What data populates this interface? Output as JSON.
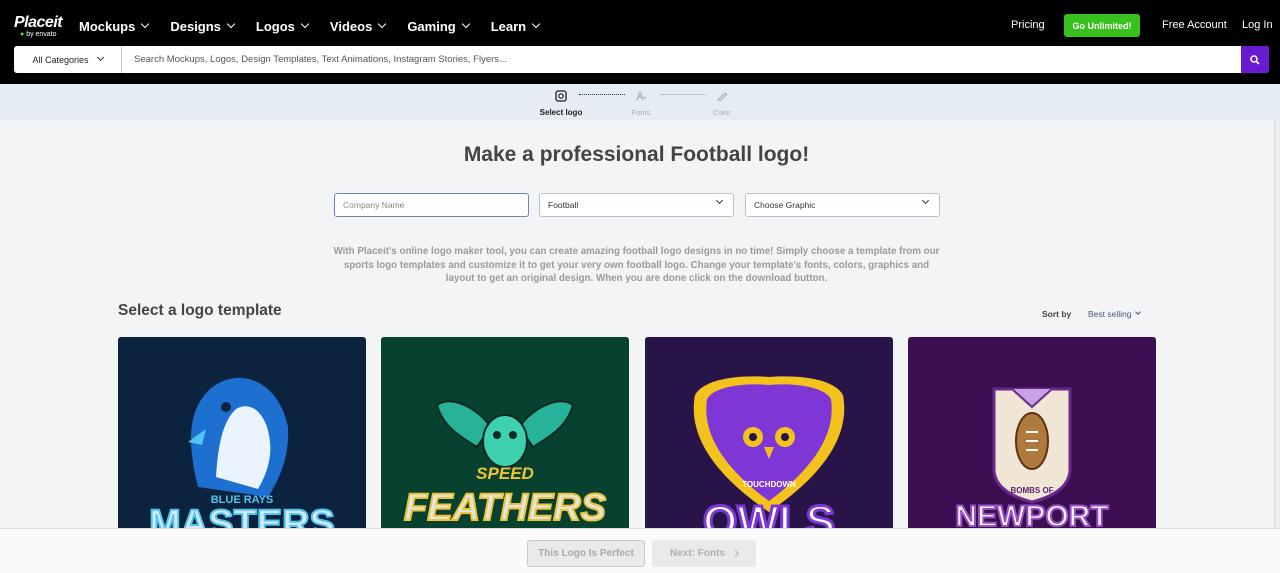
{
  "brand": {
    "name": "Placeit",
    "sub": "by envato"
  },
  "nav": {
    "menu": [
      "Mockups",
      "Designs",
      "Logos",
      "Videos",
      "Gaming",
      "Learn"
    ],
    "pricing": "Pricing",
    "cta": "Go Unlimited!",
    "free_account": "Free Account",
    "login": "Log In"
  },
  "search": {
    "category": "All Categories",
    "placeholder": "Search Mockups, Logos, Design Templates, Text Animations, Instagram Stories, Flyers..."
  },
  "steps": [
    {
      "label": "Select logo",
      "active": true
    },
    {
      "label": "Fonts",
      "active": false
    },
    {
      "label": "Color",
      "active": false
    }
  ],
  "main": {
    "title": "Make a professional Football logo!",
    "company_placeholder": "Company Name",
    "category_value": "Football",
    "graphic_value": "Choose Graphic",
    "description": "With Placeit's online logo maker tool, you can create amazing football logo designs in no time! Simply choose a template from our sports logo templates and customize it to get your very own football logo. Change your template's fonts, colors, graphics and layout to get an original design. When you are done click on the download button."
  },
  "templates": {
    "section_title": "Select a logo template",
    "sort_label": "Sort by",
    "sort_value": "Best selling",
    "cards": [
      {
        "small": "BLUE RAYS",
        "big": "MASTERS",
        "bg": "#0c2340"
      },
      {
        "small": "SPEED",
        "big": "FEATHERS",
        "bg": "#07412f"
      },
      {
        "small": "TOUCHDOWN",
        "big": "OWLS",
        "bg": "#281449"
      },
      {
        "small": "BOMBS OF",
        "big": "NEWPORT",
        "bg": "#3b0f52"
      }
    ]
  },
  "footer": {
    "perfect_button": "This Logo Is Perfect",
    "next_button": "Next: Fonts"
  },
  "colors": {
    "accent": "#6a1bd1",
    "cta": "#38c01e",
    "nav_bg": "#000000"
  },
  "icons": [
    "chevron-down-icon",
    "search-icon",
    "select-logo-icon",
    "fonts-icon",
    "color-brush-icon",
    "chevron-right-icon"
  ]
}
